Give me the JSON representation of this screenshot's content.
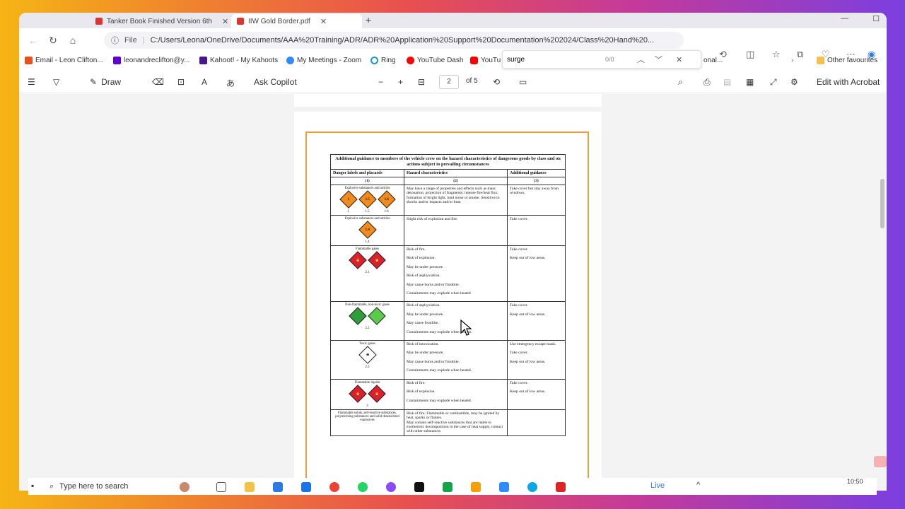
{
  "browser": {
    "tabs": [
      {
        "title": "Tanker Book Finished Version 6th",
        "active": false
      },
      {
        "title": "IIW Gold Border.pdf",
        "active": true
      }
    ],
    "address": {
      "scheme": "File",
      "url": "C:/Users/Leona/OneDrive/Documents/AAA%20Training/ADR/ADR%20Application%20Support%20Documentation%202024/Class%20Hand%20..."
    },
    "favourites": [
      {
        "label": "Email - Leon Clifton..."
      },
      {
        "label": "leonandreclifton@y..."
      },
      {
        "label": "Kahoot! - My Kahoots"
      },
      {
        "label": "My Meetings - Zoom"
      },
      {
        "label": "Ring"
      },
      {
        "label": "YouTube Dash"
      },
      {
        "label": "YouTu"
      },
      {
        "label": "onal..."
      },
      {
        "label": "Other favourites"
      }
    ],
    "find": {
      "query": "surge",
      "count": "0/0"
    }
  },
  "pdf_toolbar": {
    "draw": "Draw",
    "ask_copilot": "Ask Copilot",
    "page_current": "2",
    "page_total": "of 5",
    "edit_acrobat": "Edit with Acrobat"
  },
  "document": {
    "title": "Additional guidance to members of the vehicle crew on the hazard characteristics of dangerous goods by class and on actions subject to prevailing circumstances",
    "headers": [
      "Danger labels and placards",
      "Hazard characteristics",
      "Additional guidance"
    ],
    "col_numbers": [
      "(1)",
      "(2)",
      "(3)"
    ],
    "rows": [
      {
        "label": "Explosive substances and articles",
        "diamonds": [
          {
            "text": "1",
            "color": "#f28a1c",
            "num": "1"
          },
          {
            "text": "1.5",
            "color": "#f28a1c",
            "num": "1.5"
          },
          {
            "text": "1.6",
            "color": "#f28a1c",
            "num": "1.6"
          }
        ],
        "hazards": [
          "May have a range of properties and effects such as mass detonation; projection of fragments; intense fire/heat flux; formation of bright light, loud noise or smoke. Sensitive to shocks and/or impacts and/or heat."
        ],
        "guidance": [
          "Take cover but stay away from windows."
        ]
      },
      {
        "label": "Explosive substances and articles",
        "diamonds": [
          {
            "text": "1.4",
            "color": "#f28a1c",
            "num": "1.4"
          }
        ],
        "hazards": [
          "Slight risk of explosion and fire."
        ],
        "guidance": [
          "Take cover."
        ]
      },
      {
        "label": "Flammable gases",
        "diamonds": [
          {
            "text": "🔥",
            "color": "#d9202e",
            "num": ""
          },
          {
            "text": "🔥",
            "color": "#d9202e",
            "num": ""
          }
        ],
        "footnum": "2.1",
        "hazards": [
          "Risk of fire.",
          "Risk of explosion.",
          "May be under pressure.",
          "Risk of asphyxiation.",
          "May cause burns and/or frostbite.",
          "Containments may explode when heated"
        ],
        "guidance": [
          "Take cover.",
          "Keep out of low areas."
        ]
      },
      {
        "label": "Non-flammable, non-toxic gases",
        "diamonds": [
          {
            "text": "",
            "color": "#2e9e3a",
            "num": ""
          },
          {
            "text": "",
            "color": "#5ccb4b",
            "num": ""
          }
        ],
        "footnum": "2.2",
        "hazards": [
          "Risk of asphyxiation.",
          "May be under pressure.",
          "May cause frostbite.",
          "Containments may explode when heated."
        ],
        "guidance": [
          "Take cover.",
          "Keep out of low areas."
        ]
      },
      {
        "label": "Toxic gases",
        "diamonds": [
          {
            "text": "☠",
            "color": "#ffffff",
            "num": ""
          }
        ],
        "footnum": "2.3",
        "hazards": [
          "Risk of intoxication.",
          "May be under pressure.",
          "May cause burns and/or frostbite.",
          "Containments may explode when heated."
        ],
        "guidance": [
          "Use emergency escape mask.",
          "Take cover.",
          "Keep out of low areas."
        ]
      },
      {
        "label": "Flammable liquids",
        "diamonds": [
          {
            "text": "🔥",
            "color": "#d9202e",
            "num": ""
          },
          {
            "text": "🔥",
            "color": "#d9202e",
            "num": ""
          }
        ],
        "footnum": "3",
        "hazards": [
          "Risk of fire.",
          "Risk of explosion.",
          "Containments may explode when heated."
        ],
        "guidance": [
          "Take cover.",
          "Keep out of low areas."
        ]
      },
      {
        "label": "Flammable solids, self-reactive substances, polymerizing substances and solid desensitized explosives",
        "diamonds": [],
        "hazards": [
          "Risk of fire. Flammable or combustible, may be ignited by heat, sparks or flames.",
          "May contain self-reactive substances that are liable to exothermic decomposition in the case of heat supply, contact with other substances"
        ],
        "guidance": []
      }
    ]
  },
  "taskbar": {
    "search_placeholder": "Type here to search",
    "live": "Live",
    "time": "10:50"
  }
}
